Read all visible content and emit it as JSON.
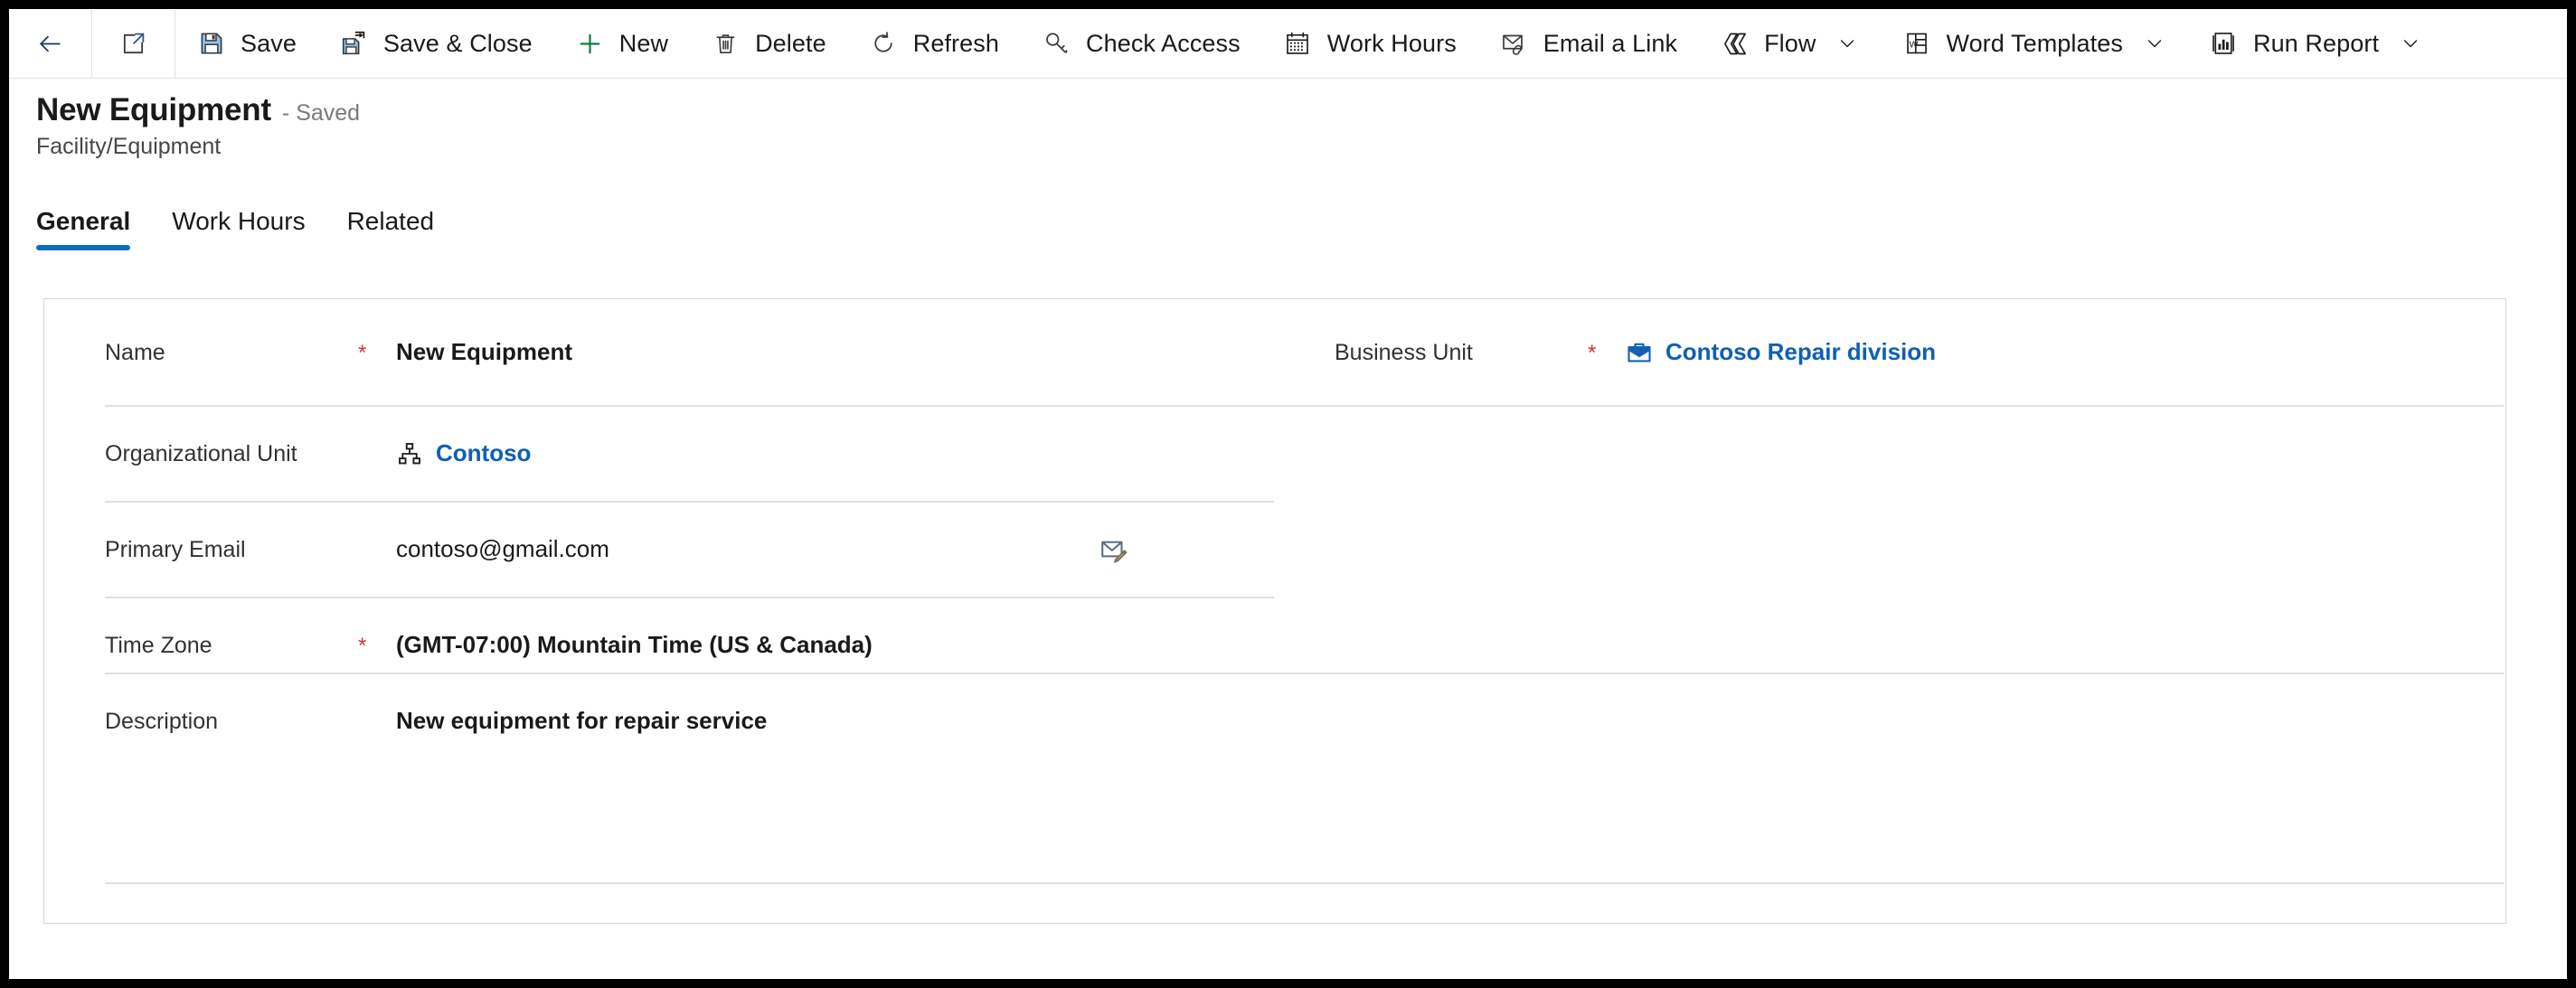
{
  "commandbar": {
    "buttons": [
      {
        "id": "back",
        "label": "",
        "icon": "back-arrow-icon",
        "icon_only": true,
        "chevron": false
      },
      {
        "id": "popout",
        "label": "",
        "icon": "open-in-new-window-icon",
        "icon_only": true,
        "chevron": false
      },
      {
        "id": "save",
        "label": "Save",
        "icon": "save-icon",
        "icon_only": false,
        "chevron": false
      },
      {
        "id": "save-close",
        "label": "Save & Close",
        "icon": "save-and-close-icon",
        "icon_only": false,
        "chevron": false
      },
      {
        "id": "new",
        "label": "New",
        "icon": "plus-icon",
        "icon_only": false,
        "chevron": false
      },
      {
        "id": "delete",
        "label": "Delete",
        "icon": "trash-icon",
        "icon_only": false,
        "chevron": false
      },
      {
        "id": "refresh",
        "label": "Refresh",
        "icon": "refresh-icon",
        "icon_only": false,
        "chevron": false
      },
      {
        "id": "check-access",
        "label": "Check Access",
        "icon": "key-icon",
        "icon_only": false,
        "chevron": false
      },
      {
        "id": "work-hours",
        "label": "Work Hours",
        "icon": "calendar-icon",
        "icon_only": false,
        "chevron": false
      },
      {
        "id": "email-a-link",
        "label": "Email a Link",
        "icon": "email-link-icon",
        "icon_only": false,
        "chevron": false
      },
      {
        "id": "flow",
        "label": "Flow",
        "icon": "flow-icon",
        "icon_only": false,
        "chevron": true
      },
      {
        "id": "word-templates",
        "label": "Word Templates",
        "icon": "word-doc-icon",
        "icon_only": false,
        "chevron": true
      },
      {
        "id": "run-report",
        "label": "Run Report",
        "icon": "report-chart-icon",
        "icon_only": false,
        "chevron": true
      }
    ]
  },
  "header": {
    "title": "New Equipment",
    "status": "- Saved",
    "subtitle": "Facility/Equipment"
  },
  "tabs": [
    {
      "label": "General",
      "active": true
    },
    {
      "label": "Work Hours",
      "active": false
    },
    {
      "label": "Related",
      "active": false
    }
  ],
  "form": {
    "fields": {
      "name": {
        "label": "Name",
        "required": "*",
        "value": "New Equipment"
      },
      "business_unit": {
        "label": "Business Unit",
        "required": "*",
        "value": "Contoso Repair division",
        "icon": "briefcase-icon"
      },
      "organizational_unit": {
        "label": "Organizational Unit",
        "required": "",
        "value": "Contoso",
        "icon": "org-hierarchy-icon"
      },
      "primary_email": {
        "label": "Primary Email",
        "required": "",
        "value": "contoso@gmail.com",
        "trailing_icon": "compose-email-icon"
      },
      "time_zone": {
        "label": "Time Zone",
        "required": "*",
        "value": "(GMT-07:00) Mountain Time (US & Canada)"
      },
      "description": {
        "label": "Description",
        "required": "",
        "value": "New equipment for repair service"
      }
    }
  },
  "colors": {
    "accent": "#0f6cbd",
    "link": "#0f5fb5",
    "required": "#d13438",
    "text": "#1b1a19",
    "label": "#323130",
    "muted": "#7a7a7a",
    "divider": "#e1dfdd",
    "card_border": "#d6d6d6"
  }
}
